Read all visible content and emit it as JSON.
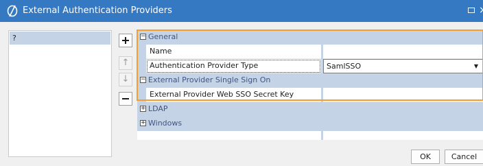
{
  "window": {
    "title": "External Authentication Providers"
  },
  "left_list": {
    "items": [
      "?"
    ]
  },
  "side_buttons": {
    "add": "+",
    "move_up": "↑",
    "move_down": "↓",
    "remove": "−"
  },
  "grid": {
    "categories": [
      {
        "label": "General",
        "expanded": true,
        "properties": [
          {
            "name": "Name",
            "value": ""
          },
          {
            "name": "Authentication Provider Type",
            "value": "SamlSSO"
          }
        ]
      },
      {
        "label": "External Provider Single Sign On",
        "expanded": true,
        "properties": [
          {
            "name": "External Provider Web SSO Secret Key",
            "value": ""
          }
        ]
      },
      {
        "label": "LDAP",
        "expanded": false,
        "properties": []
      },
      {
        "label": "Windows",
        "expanded": false,
        "properties": []
      }
    ]
  },
  "buttons": {
    "ok": "OK",
    "cancel": "Cancel"
  },
  "colors": {
    "titlebar": "#3579c3",
    "category_bg": "#c5d3e7",
    "highlight": "#f0a030"
  }
}
